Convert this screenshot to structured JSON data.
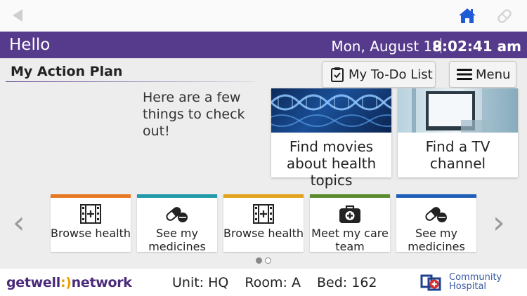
{
  "topbar": {
    "back_icon": "back-arrow-icon",
    "home_icon": "home-icon",
    "pill_icon": "pill-icon"
  },
  "header": {
    "greeting": "Hello",
    "date": "Mon, August 19",
    "time": "8:02:41 am",
    "color": "#563b8c"
  },
  "plan": {
    "title": "My Action Plan",
    "todo_label": "My To-Do List",
    "menu_label": "Menu",
    "intro": "Here are a few things to check out!"
  },
  "features": [
    {
      "label": "Find movies about health topics",
      "image": "dna-image"
    },
    {
      "label": "Find a TV channel",
      "image": "tv-image"
    }
  ],
  "cards": [
    {
      "label": "Browse health",
      "icon": "film-icon",
      "color": "#e87722"
    },
    {
      "label": "See my medicines",
      "icon": "pills-icon",
      "color": "#1e9aa8"
    },
    {
      "label": "Browse health",
      "icon": "film-icon",
      "color": "#e3a21a"
    },
    {
      "label": "Meet my care team",
      "icon": "medical-bag-icon",
      "color": "#5a8a2c"
    },
    {
      "label": "See my medicines",
      "icon": "pills-icon",
      "color": "#1f5fb8"
    }
  ],
  "carousel": {
    "pages": 2,
    "current": 1
  },
  "footer": {
    "brand_a": "getwell",
    "brand_paren": ":)",
    "brand_b": "network",
    "unit": "Unit: HQ",
    "room": "Room: A",
    "bed": "Bed: 162",
    "hospital_line1": "Community",
    "hospital_line2": "Hospital"
  }
}
